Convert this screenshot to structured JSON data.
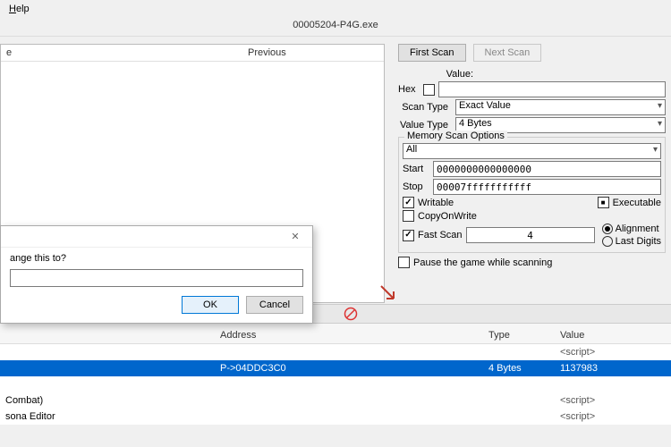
{
  "menubar": {
    "help_label": "Help"
  },
  "window": {
    "title": "00005204-P4G.exe"
  },
  "results": {
    "col_value": "e",
    "col_prev": "Previous"
  },
  "scan": {
    "first_scan": "First Scan",
    "next_scan": "Next Scan",
    "value_label": "Value:",
    "hex_label": "Hex",
    "hex_checked": false,
    "value": "",
    "scan_type_label": "Scan Type",
    "scan_type": "Exact Value",
    "value_type_label": "Value Type",
    "value_type": "4 Bytes",
    "memory_options_title": "Memory Scan Options",
    "region": "All",
    "start_label": "Start",
    "start": "0000000000000000",
    "stop_label": "Stop",
    "stop": "00007fffffffffff",
    "writable_label": "Writable",
    "writable_checked": true,
    "executable_label": "Executable",
    "executable_state": "filled",
    "cow_label": "CopyOnWrite",
    "cow_checked": false,
    "fast_scan_label": "Fast Scan",
    "fast_scan_checked": true,
    "fast_scan_value": "4",
    "alignment_label": "Alignment",
    "lastdigits_label": "Last Digits",
    "align_mode": "alignment",
    "pause_label": "Pause the game while scanning",
    "pause_checked": false
  },
  "table": {
    "col_desc": "",
    "col_addr": "Address",
    "col_type": "Type",
    "col_value": "Value",
    "script_text": "<script>",
    "rows": [
      {
        "desc": "",
        "addr": "",
        "type": "",
        "value": "<script>",
        "selected": false
      },
      {
        "desc": "",
        "addr": "P->04DDC3C0",
        "type": "4 Bytes",
        "value": "1137983",
        "selected": true
      },
      {
        "desc": "",
        "addr": "",
        "type": "",
        "value": "",
        "selected": false
      },
      {
        "desc": "Combat)",
        "addr": "",
        "type": "",
        "value": "<script>",
        "selected": false
      },
      {
        "desc": "sona Editor",
        "addr": "",
        "type": "",
        "value": "<script>",
        "selected": false
      }
    ]
  },
  "dialog": {
    "prompt": "ange this to?",
    "value": "",
    "ok": "OK",
    "cancel": "Cancel"
  }
}
